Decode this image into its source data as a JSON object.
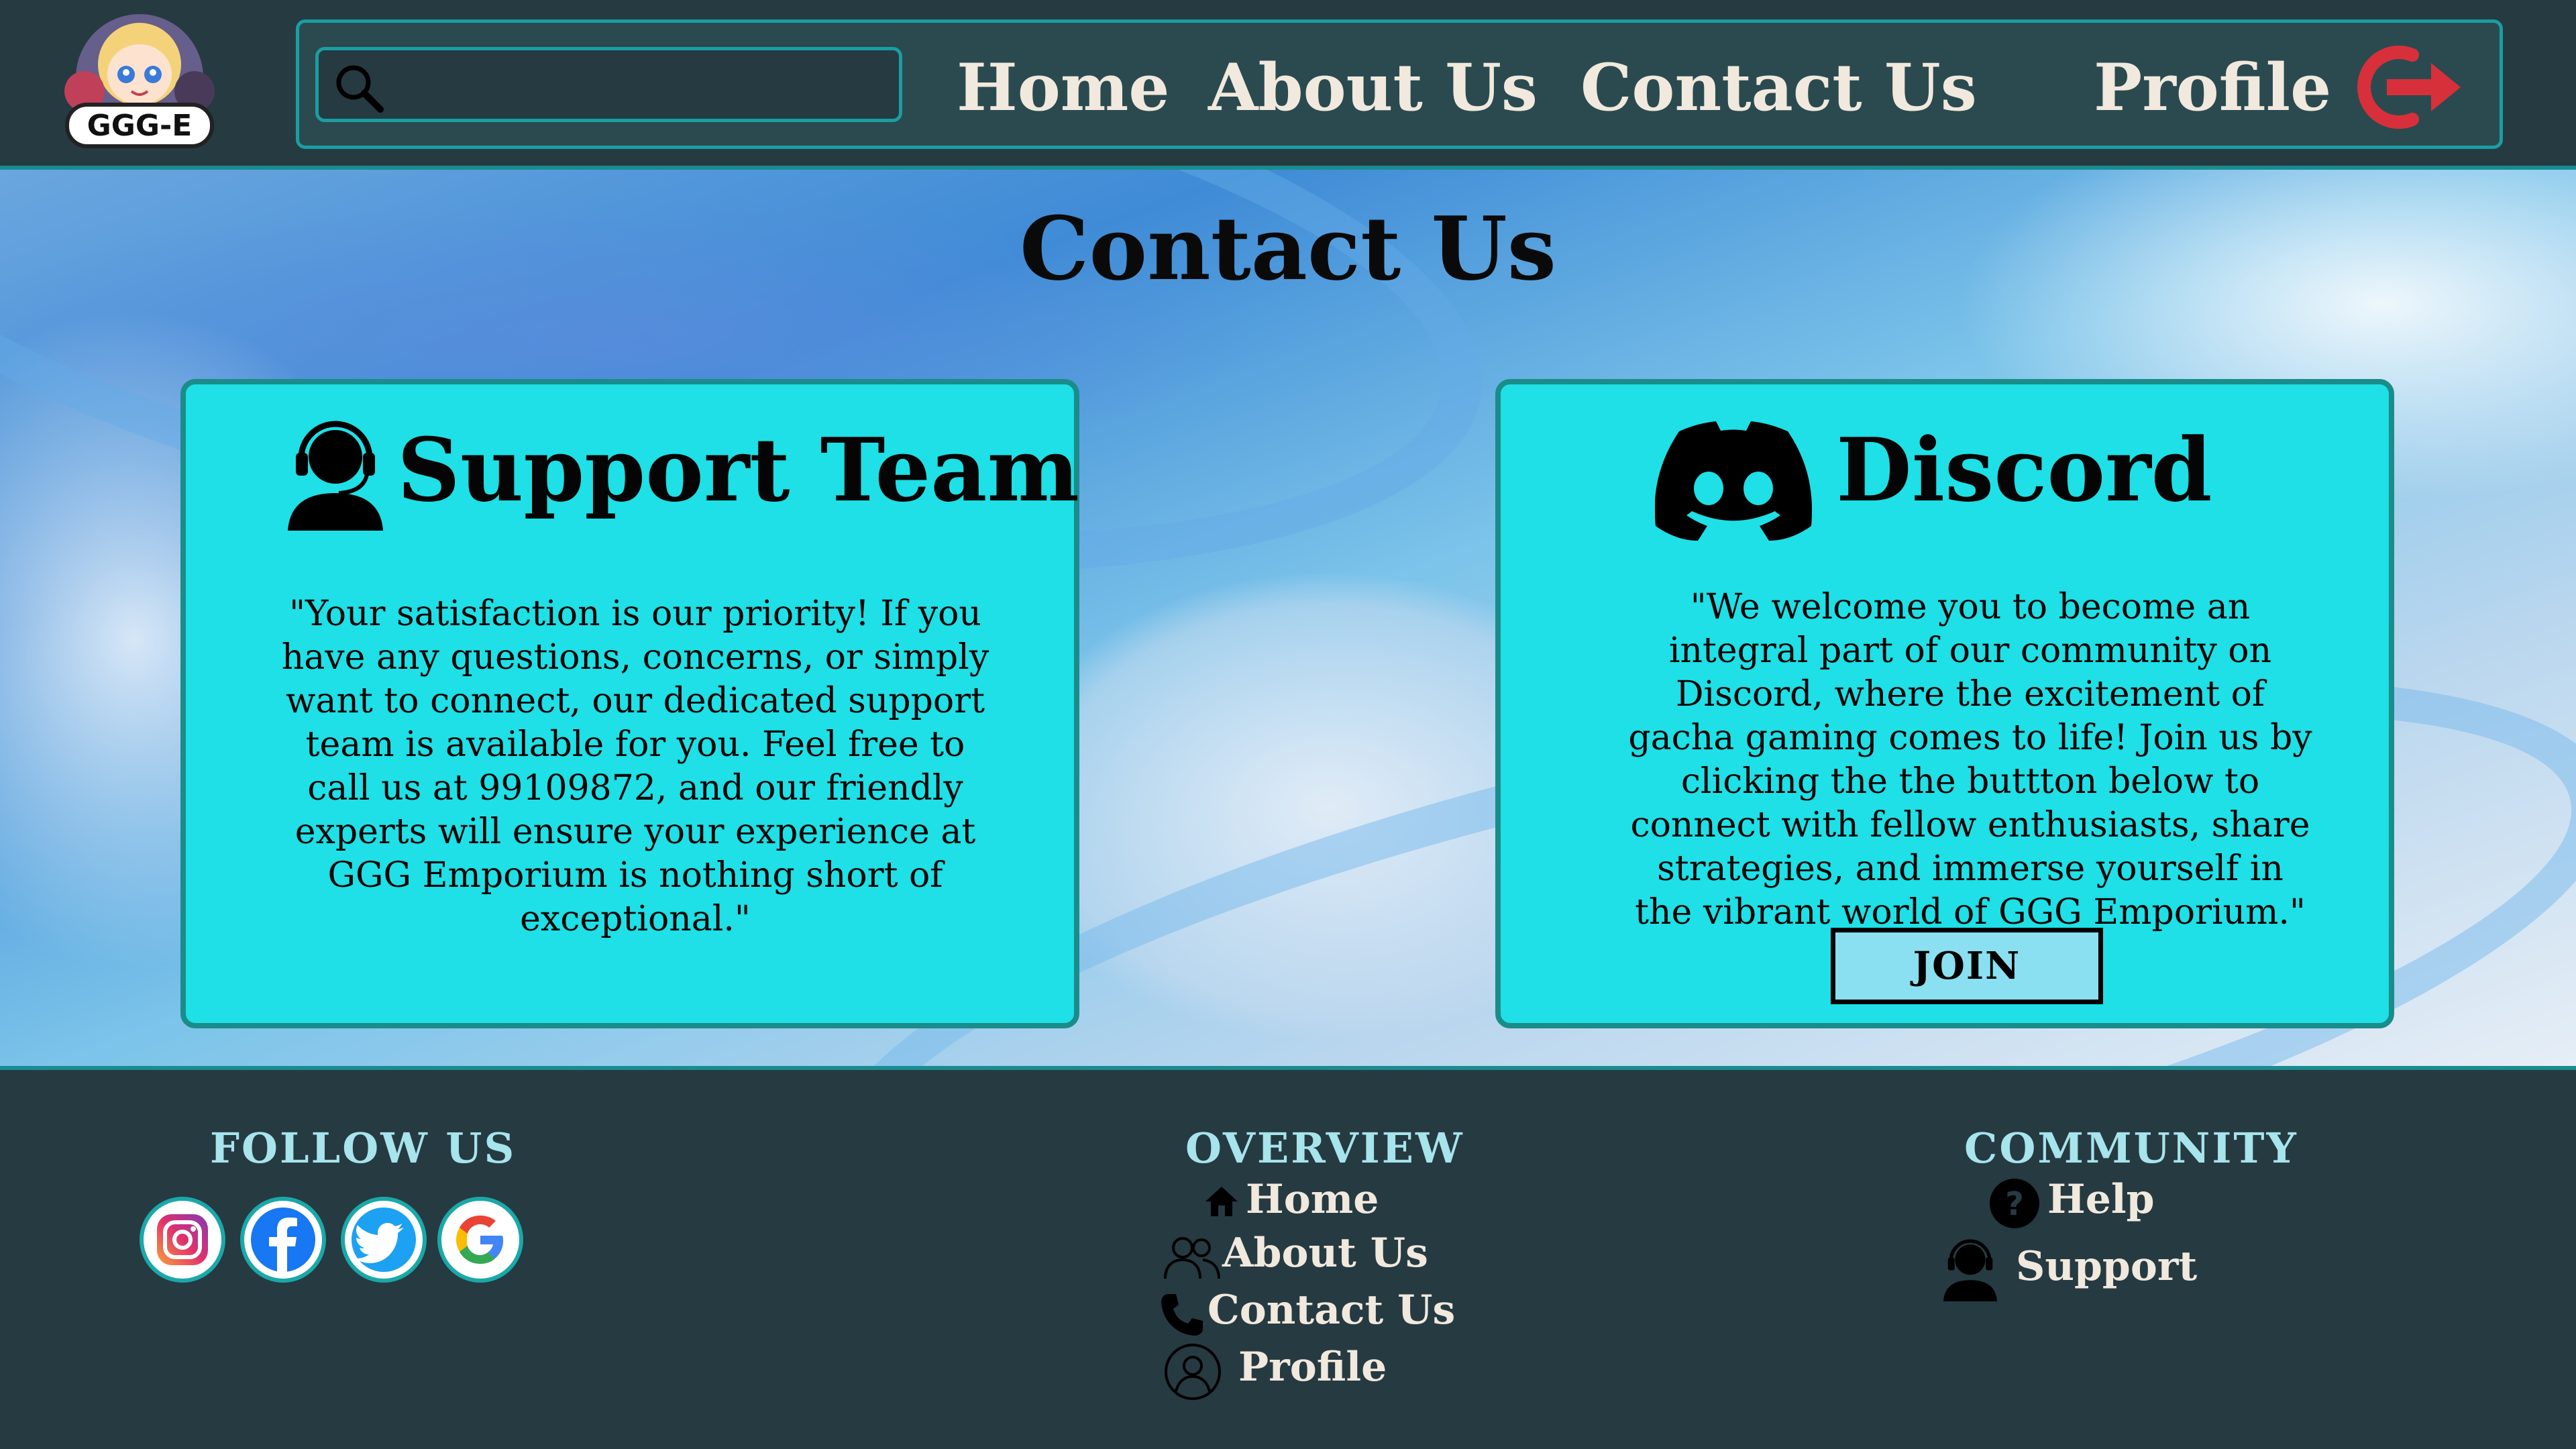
{
  "header": {
    "logo_text": "GGG-E",
    "search": {
      "placeholder": "",
      "value": ""
    },
    "nav": {
      "home": "Home",
      "about": "About Us",
      "contact": "Contact Us",
      "profile": "Profile"
    }
  },
  "main": {
    "title": "Contact Us",
    "support": {
      "heading": "Support Team",
      "text": "\"Your satisfaction is our priority! If you have any questions, concerns, or simply want to connect, our dedicated support team is available for you. Feel free to call us at 99109872, and our friendly experts will ensure your experience at GGG Emporium is nothing short of exceptional.\""
    },
    "discord": {
      "heading": "Discord",
      "text": "\"We welcome you to become an integral part of our community on Discord, where the excitement of gacha gaming comes to life! Join us by clicking the the buttton below to connect with fellow enthusiasts, share strategies, and immerse yourself in the vibrant world of GGG Emporium.\"",
      "button": "JOIN"
    }
  },
  "footer": {
    "follow": {
      "heading": "FOLLOW US",
      "icons": [
        "instagram-icon",
        "facebook-icon",
        "twitter-icon",
        "google-icon"
      ]
    },
    "overview": {
      "heading": "OVERVIEW",
      "links": [
        "Home",
        "About Us",
        "Contact Us",
        "Profile"
      ]
    },
    "community": {
      "heading": "COMMUNITY",
      "links": [
        "Help",
        "Support"
      ]
    }
  },
  "colors": {
    "header_bg": "#263a42",
    "card_bg": "#1ee0e6",
    "card_border": "#1a8c8a",
    "accent_teal": "#1a9ea2",
    "logout_red": "#d8303a",
    "footer_heading": "#a7e4ec"
  }
}
